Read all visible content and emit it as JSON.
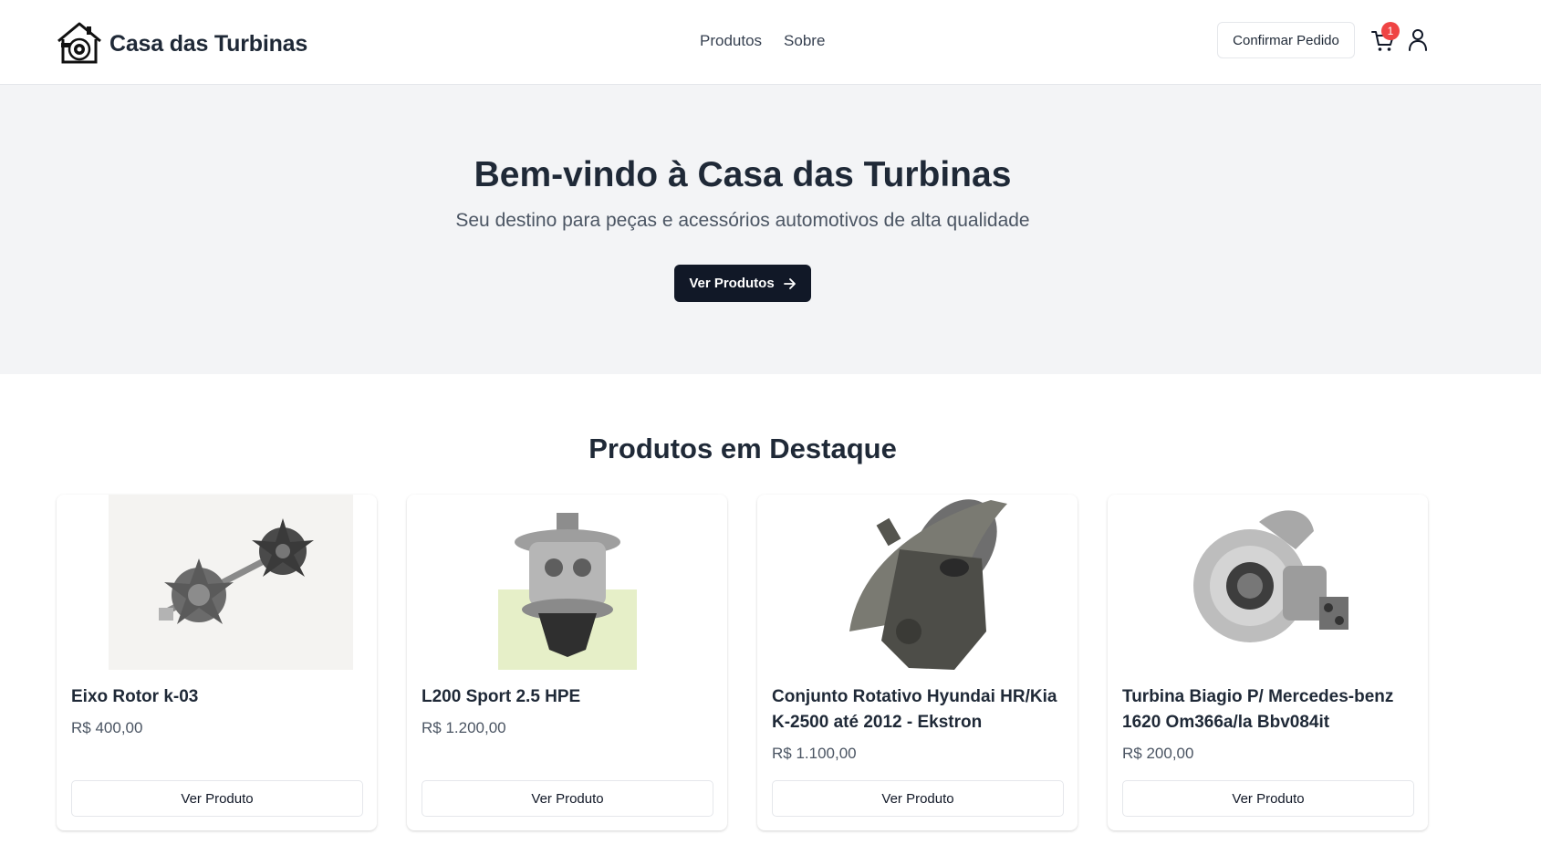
{
  "header": {
    "brand": "Casa das Turbinas",
    "nav": [
      "Produtos",
      "Sobre"
    ],
    "confirm_label": "Confirmar Pedido",
    "cart_count": "1"
  },
  "hero": {
    "title": "Bem-vindo à Casa das Turbinas",
    "subtitle": "Seu destino para peças e acessórios automotivos de alta qualidade",
    "button_label": "Ver Produtos"
  },
  "featured": {
    "title": "Produtos em Destaque",
    "products": [
      {
        "name": "Eixo Rotor k-03",
        "price": "R$ 400,00",
        "button": "Ver Produto",
        "image": "turbine-shaft-rotor"
      },
      {
        "name": "L200 Sport 2.5 HPE",
        "price": "R$ 1.200,00",
        "button": "Ver Produto",
        "image": "turbo-cartridge"
      },
      {
        "name": "Conjunto Rotativo Hyundai HR/Kia K-2500 até 2012 - Ekstron",
        "price": "R$ 1.100,00",
        "button": "Ver Produto",
        "image": "turbo-center-housing"
      },
      {
        "name": "Turbina Biagio P/ Mercedes-benz 1620 Om366a/la Bbv084it",
        "price": "R$ 200,00",
        "button": "Ver Produto",
        "image": "turbocharger"
      }
    ]
  },
  "colors": {
    "primary": "#111827",
    "hero_bg": "#f3f4f6",
    "badge": "#ef4444"
  }
}
